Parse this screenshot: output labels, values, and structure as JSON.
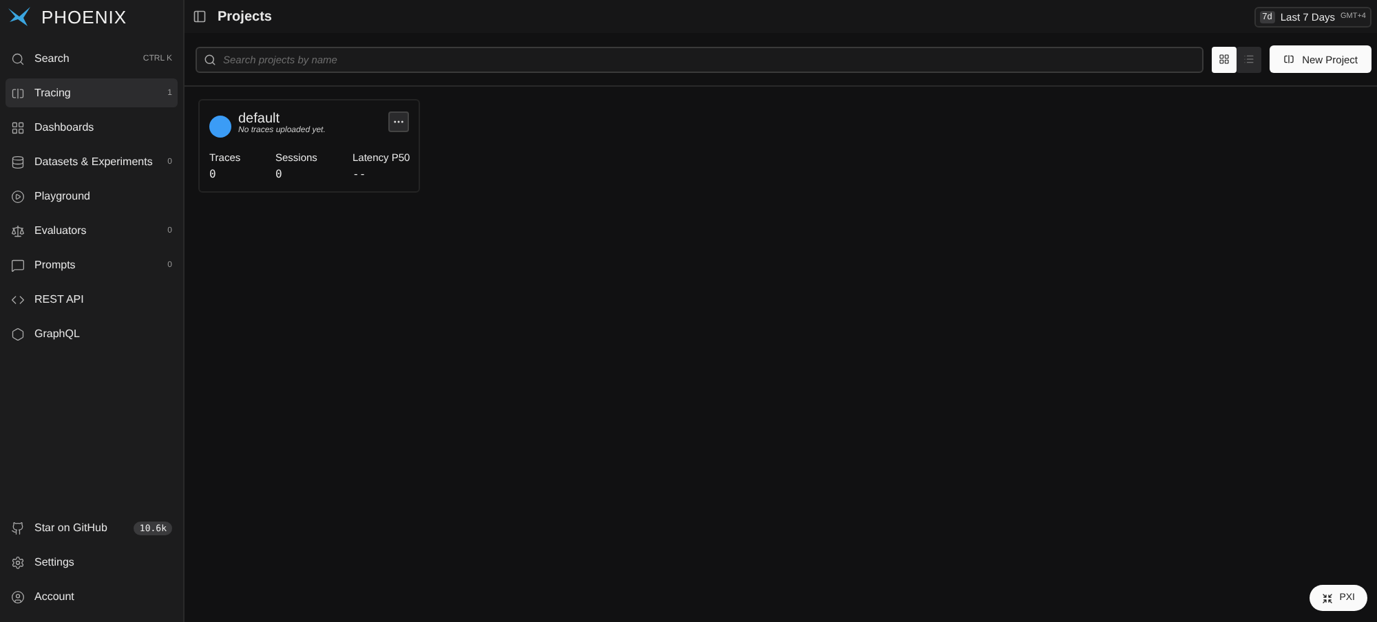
{
  "sidebar": {
    "brand": "PHOENIX",
    "items": [
      {
        "label": "Search",
        "badge": "CTRL K",
        "selected": false
      },
      {
        "label": "Tracing",
        "badge": "1",
        "selected": true
      },
      {
        "label": "Dashboards",
        "selected": false
      },
      {
        "label": "Datasets & Experiments",
        "badge": "0",
        "selected": false
      },
      {
        "label": "Playground",
        "selected": false
      },
      {
        "label": "Evaluators",
        "badge": "0",
        "selected": false
      },
      {
        "label": "Prompts",
        "badge": "0",
        "selected": false
      },
      {
        "label": "REST API",
        "selected": false
      },
      {
        "label": "GraphQL",
        "selected": false
      }
    ],
    "footer": [
      {
        "label": "Star on GitHub",
        "badge": "10.6k"
      },
      {
        "label": "Settings"
      },
      {
        "label": "Account"
      }
    ]
  },
  "header": {
    "title": "Projects",
    "time_range": {
      "short": "7d",
      "label": "Last 7 Days",
      "timezone": "GMT+4"
    }
  },
  "toolbar": {
    "search": {
      "placeholder": "Search projects by name"
    },
    "views": [
      {
        "selected": true
      },
      {
        "selected": false
      }
    ],
    "new_button": "New Project"
  },
  "projects": [
    {
      "name": "default",
      "subtitle": "No traces uploaded yet.",
      "color": "#3b9cf6",
      "stats": [
        {
          "label": "Traces",
          "value": "0"
        },
        {
          "label": "Sessions",
          "value": "0"
        },
        {
          "label": "Latency P50",
          "value": "--"
        }
      ]
    }
  ],
  "assistant_button": "PXI"
}
